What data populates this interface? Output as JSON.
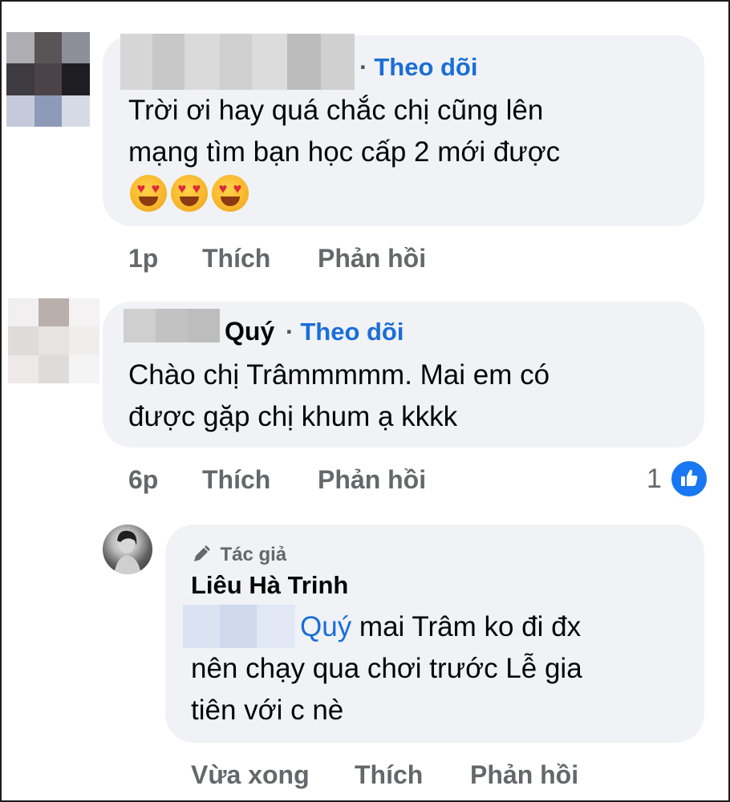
{
  "comments": [
    {
      "follow_label": "Theo dõi",
      "text_lines": [
        "Trời ơi hay quá chắc chị cũng lên",
        "mạng tìm bạn học cấp 2 mới được"
      ],
      "emojis": [
        "heart-eyes",
        "heart-eyes",
        "heart-eyes"
      ],
      "time": "1p",
      "like_label": "Thích",
      "reply_label": "Phản hồi"
    },
    {
      "name_suffix": "Quý",
      "follow_label": "Theo dõi",
      "text_lines": [
        "Chào chị Trâmmmmm. Mai em có",
        "được gặp chị khum ạ kkkk"
      ],
      "time": "6p",
      "like_label": "Thích",
      "reply_label": "Phản hồi",
      "reaction_count": "1",
      "reaction_type": "like"
    }
  ],
  "reply": {
    "author_badge": "Tác giả",
    "author_name": "Liêu Hà Trinh",
    "mention": "Quý",
    "text_line1_rest": " mai Trâm ko đi đx",
    "text_line2": "nên chạy qua chơi trước Lễ gia",
    "text_line3": "tiên với c nè",
    "time": "Vừa xong",
    "like_label": "Thích",
    "reply_label": "Phản hồi"
  },
  "colors": {
    "bubble": "#f0f2f5",
    "link_blue": "#1a6ed8",
    "muted": "#65676b",
    "like_blue": "#1877f2"
  }
}
